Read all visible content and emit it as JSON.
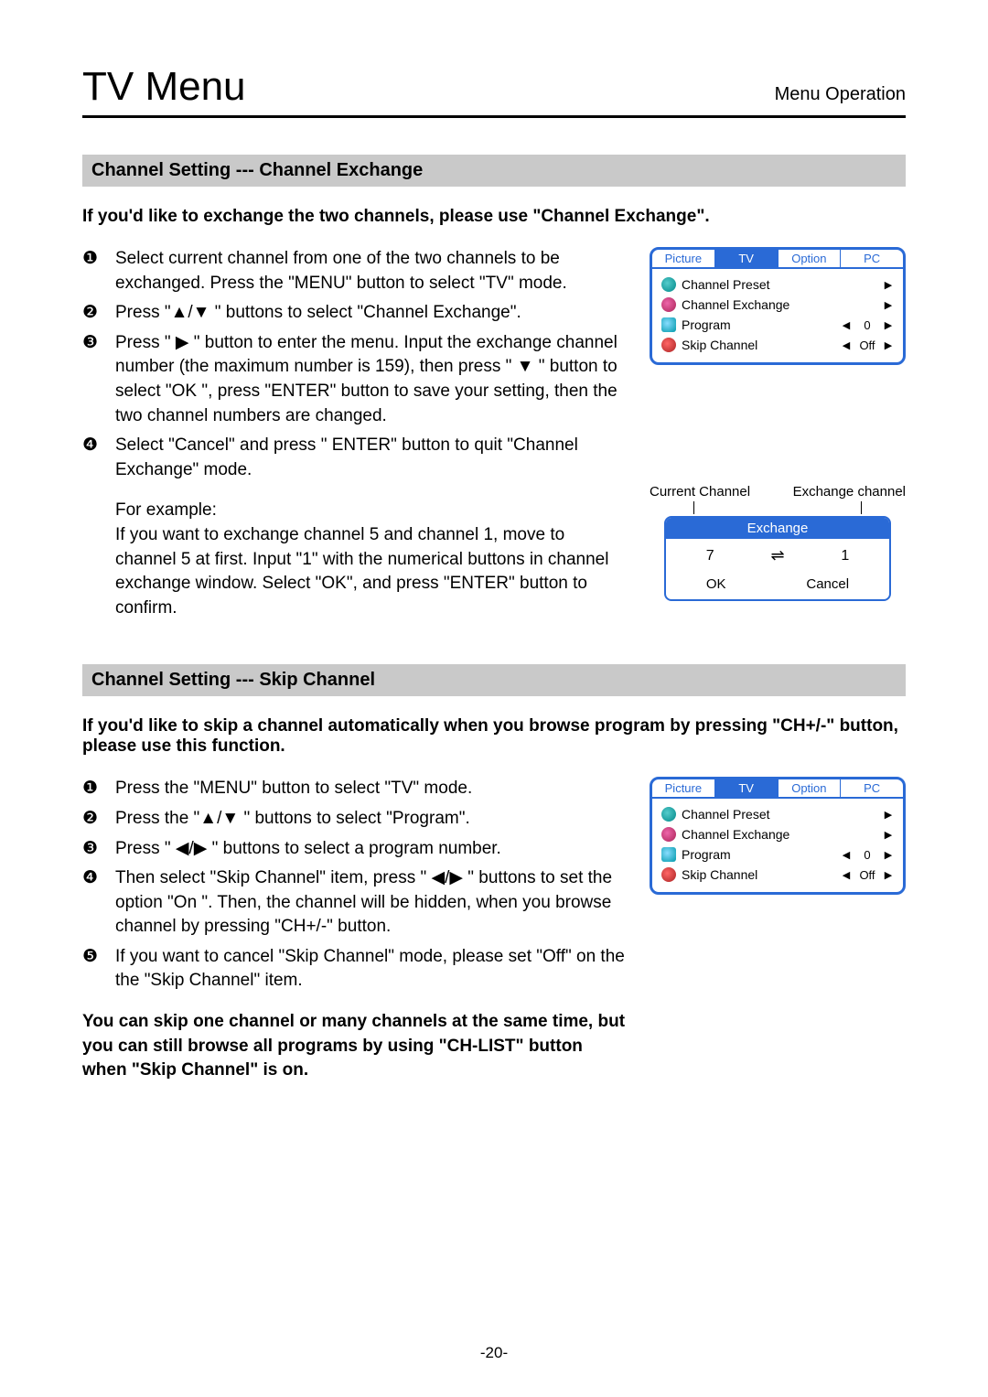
{
  "header": {
    "title": "TV Menu",
    "subtitle": "Menu Operation"
  },
  "section1": {
    "bar": "Channel Setting --- Channel Exchange",
    "intro": "If you'd like to exchange the two channels, please use \"Channel Exchange\".",
    "steps": [
      "Select current channel from one of the two channels to be exchanged. Press the \"MENU\" button to select \"TV\" mode.",
      "Press \"▲/▼ \" buttons to select \"Channel Exchange\".",
      "Press \" ▶ \" button to enter the menu. Input the exchange channel number (the maximum number is 159), then press \" ▼ \" button to select \"OK \", press \"ENTER\" button to save your setting, then the two channel numbers are changed.",
      "Select \"Cancel\" and press \" ENTER\" button to quit \"Channel Exchange\" mode."
    ],
    "example_label": "For example:",
    "example_text": "If you want to exchange channel 5 and channel 1, move to channel 5 at first. Input \"1\" with the numerical buttons in channel exchange window. Select \"OK\", and press \"ENTER\" button to confirm."
  },
  "osd": {
    "tabs": [
      "Picture",
      "TV",
      "Option",
      "PC"
    ],
    "active_tab": "TV",
    "rows": [
      {
        "label": "Channel Preset",
        "value": "",
        "left": false,
        "right": true
      },
      {
        "label": "Channel Exchange",
        "value": "",
        "left": false,
        "right": true
      },
      {
        "label": "Program",
        "value": "0",
        "left": true,
        "right": true
      },
      {
        "label": "Skip Channel",
        "value": "Off",
        "left": true,
        "right": true
      }
    ]
  },
  "exchange": {
    "left_label": "Current Channel",
    "right_label": "Exchange channel",
    "title": "Exchange",
    "current": "7",
    "target": "1",
    "ok": "OK",
    "cancel": "Cancel"
  },
  "section2": {
    "bar": "Channel Setting --- Skip Channel",
    "intro": "If you'd like to skip a channel automatically when you browse program by pressing \"CH+/-\" button, please use this function.",
    "steps": [
      "Press the \"MENU\" button to select \"TV\" mode.",
      "Press the \"▲/▼ \" buttons to select \"Program\".",
      "Press \" ◀/▶ \" buttons to select a program number.",
      "Then select \"Skip Channel\" item, press \" ◀/▶ \" buttons to set the option \"On \". Then, the channel will be hidden, when you browse channel by pressing \"CH+/-\" button.",
      "If you want to cancel \"Skip Channel\" mode, please set \"Off\" on the the \"Skip Channel\" item."
    ],
    "outro": "You can skip one channel or many channels at the same time, but you can still browse all programs by using \"CH-LIST\" button when \"Skip Channel\" is on."
  },
  "bullets": [
    "❶",
    "❷",
    "❸",
    "❹",
    "❺"
  ],
  "page_number": "-20-"
}
